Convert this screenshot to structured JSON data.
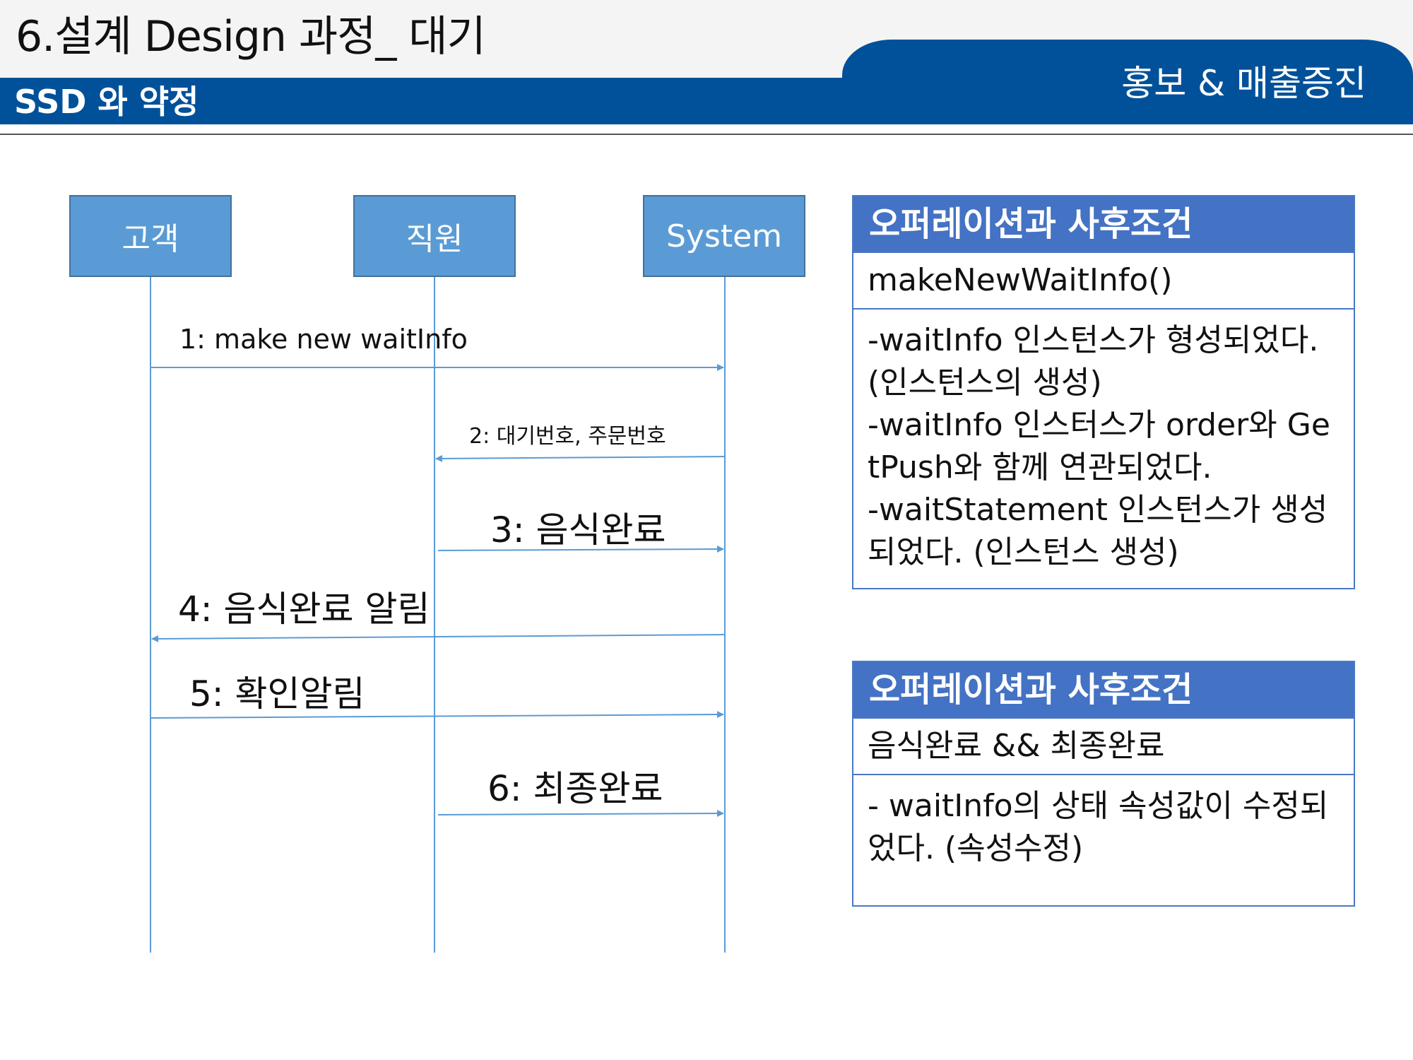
{
  "header": {
    "title": "6.설계 Design 과정_ 대기",
    "subtitle": "SSD 와 약정",
    "tab_label": "홍보 & 매출증진"
  },
  "sequence": {
    "actors": [
      "고객",
      "직원",
      "System"
    ],
    "messages": [
      {
        "label": "1: make new waitInfo",
        "from": "고객",
        "to": "System"
      },
      {
        "label": "2: 대기번호, 주문번호",
        "from": "System",
        "to": "직원"
      },
      {
        "label": "3: 음식완료",
        "from": "직원",
        "to": "System"
      },
      {
        "label": "4: 음식완료 알림",
        "from": "System",
        "to": "고객"
      },
      {
        "label": "5: 확인알림",
        "from": "고객",
        "to": "System"
      },
      {
        "label": "6: 최종완료",
        "from": "직원",
        "to": "System"
      }
    ]
  },
  "cards": [
    {
      "header": "오퍼레이션과 사후조건",
      "operation": "makeNewWaitInfo()",
      "postconditions": "-waitInfo 인스턴스가 형성되었다. (인스턴스의 생성)\n-waitInfo 인스터스가 order와 GetPush와 함께 연관되었다.\n-waitStatement 인스턴스가 생성되었다. (인스턴스 생성)"
    },
    {
      "header": "오퍼레이션과 사후조건",
      "operation": "음식완료 && 최종완료",
      "postconditions": "- waitInfo의 상태 속성값이 수정되었다. (속성수정)"
    }
  ],
  "colors": {
    "band": "#01519a",
    "actor_fill": "#5b9bd5",
    "card_header": "#4472c4",
    "line": "#5b9bd5"
  }
}
